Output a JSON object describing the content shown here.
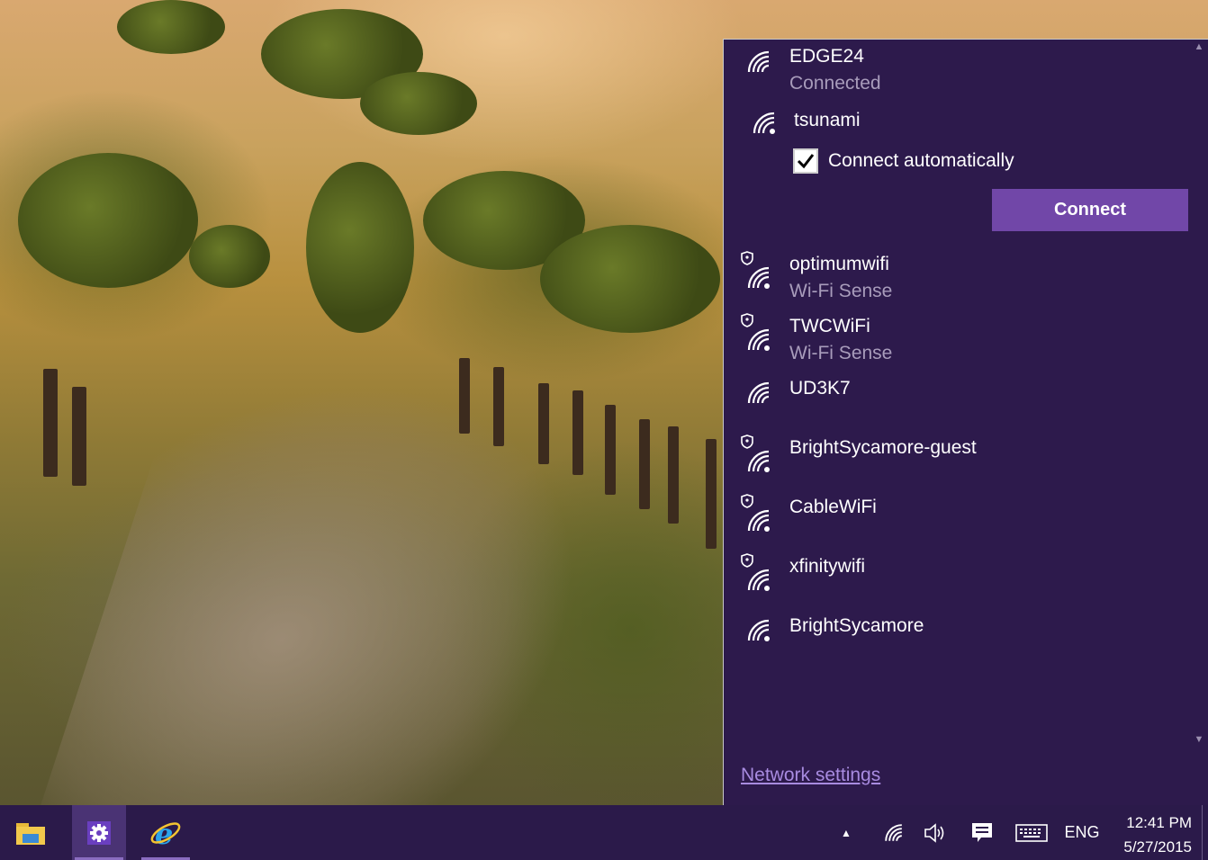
{
  "flyout": {
    "networks": [
      {
        "name": "EDGE24",
        "status": "Connected",
        "secured_shield": false
      },
      {
        "name": "tsunami",
        "status": "",
        "secured_shield": false,
        "expanded": true
      },
      {
        "name": "optimumwifi",
        "status": "Wi-Fi Sense",
        "secured_shield": true
      },
      {
        "name": "TWCWiFi",
        "status": "Wi-Fi Sense",
        "secured_shield": true
      },
      {
        "name": "UD3K7",
        "status": "",
        "secured_shield": false
      },
      {
        "name": "BrightSycamore-guest",
        "status": "",
        "secured_shield": true
      },
      {
        "name": "CableWiFi",
        "status": "",
        "secured_shield": true
      },
      {
        "name": "xfinitywifi",
        "status": "",
        "secured_shield": true
      },
      {
        "name": "BrightSycamore",
        "status": "",
        "secured_shield": false
      }
    ],
    "connect_automatically_label": "Connect automatically",
    "connect_automatically_checked": true,
    "connect_button_label": "Connect",
    "network_settings_label": "Network settings",
    "icon": "wifi-icon"
  },
  "taskbar": {
    "apps": [
      {
        "name": "file-explorer-icon",
        "active": false
      },
      {
        "name": "settings-gear-icon",
        "active": true
      },
      {
        "name": "internet-explorer-icon",
        "active": false
      }
    ],
    "tray": {
      "language": "ENG",
      "time": "12:41 PM",
      "date": "5/27/2015"
    }
  },
  "colors": {
    "flyout_bg": "#2d1a4c",
    "accent": "#7147a8",
    "taskbar_bg": "#2b1a4a",
    "link": "#a88be0"
  }
}
